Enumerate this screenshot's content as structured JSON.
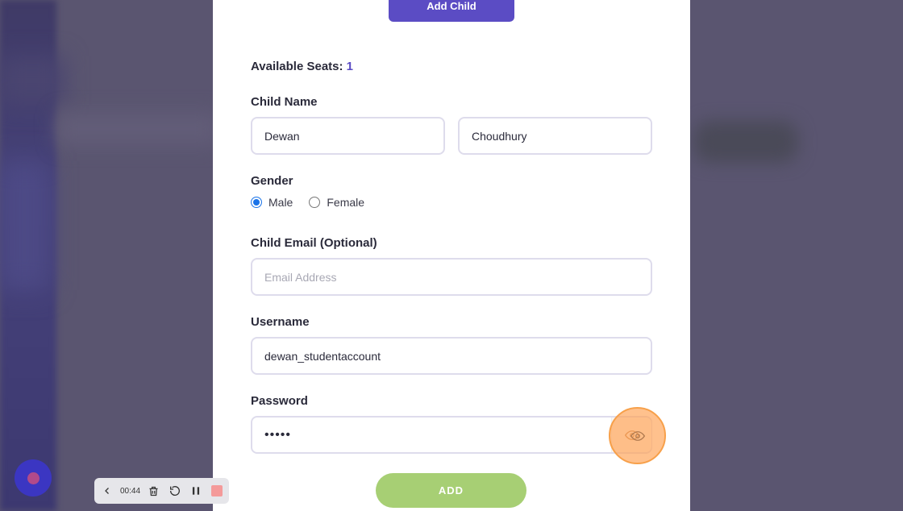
{
  "modal": {
    "header_button": "Add Child",
    "seats": {
      "label": "Available Seats:",
      "value": "1"
    },
    "child_name": {
      "label": "Child Name",
      "first_name_value": "Dewan",
      "last_name_value": "Choudhury"
    },
    "gender": {
      "label": "Gender",
      "options": [
        "Male",
        "Female"
      ],
      "selected": "Male"
    },
    "email": {
      "label": "Child Email (Optional)",
      "placeholder": "Email Address",
      "value": ""
    },
    "username": {
      "label": "Username",
      "value": "dewan_studentaccount"
    },
    "password": {
      "label": "Password",
      "value": "•••••"
    },
    "submit_button": "ADD"
  },
  "recorder": {
    "elapsed": "00:44",
    "icons": [
      "chevron-left-icon",
      "trash-icon",
      "restart-icon",
      "pause-icon",
      "stop-icon"
    ]
  },
  "colors": {
    "accent": "#5b4cc4",
    "add_button": "#a7cf74",
    "highlight": "#f7a04a",
    "radio_selected": "#1a73e8"
  }
}
